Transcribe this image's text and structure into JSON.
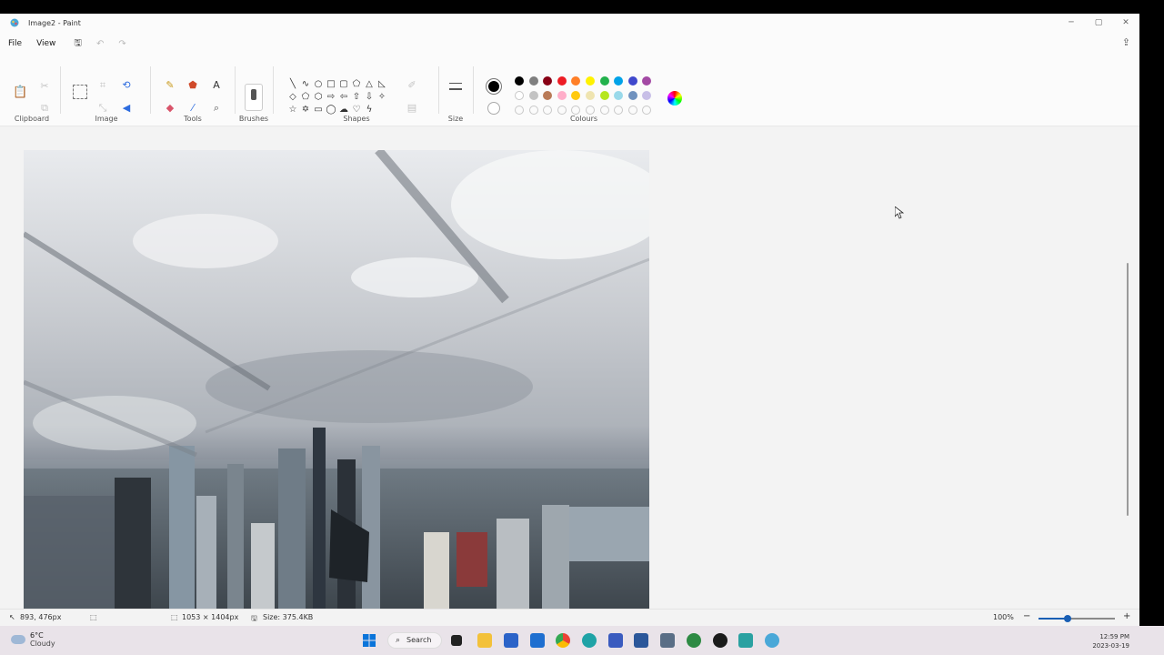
{
  "window": {
    "title": "Image2 - Paint"
  },
  "menu": {
    "file": "File",
    "view": "View"
  },
  "ribbon": {
    "groups": {
      "clipboard": "Clipboard",
      "image": "Image",
      "tools": "Tools",
      "brushes": "Brushes",
      "shapes": "Shapes",
      "size": "Size",
      "colours": "Colours"
    },
    "selected_color_primary": "#000000",
    "selected_color_secondary": "#ffffff",
    "palette_row1": [
      "#000000",
      "#7f7f7f",
      "#880015",
      "#ed1c24",
      "#ff7f27",
      "#fff200",
      "#22b14c",
      "#00a2e8",
      "#3f48cc",
      "#a349a4"
    ],
    "palette_row2": [
      "#ffffff",
      "#c3c3c3",
      "#b97a57",
      "#ffaec9",
      "#ffc90e",
      "#efe4b0",
      "#b5e61d",
      "#99d9ea",
      "#7092be",
      "#c8bfe7"
    ],
    "palette_row3_empty_count": 10
  },
  "status": {
    "cursor_pos": "893, 476px",
    "selection": "",
    "dimensions": "1053 × 1404px",
    "size": "Size: 375.4KB",
    "zoom": "100%",
    "zoom_level_fraction": 0.38
  },
  "taskbar": {
    "temp": "6°C",
    "condition": "Cloudy",
    "search": "Search",
    "time": "12:59 PM",
    "date": "2023-03-19"
  }
}
